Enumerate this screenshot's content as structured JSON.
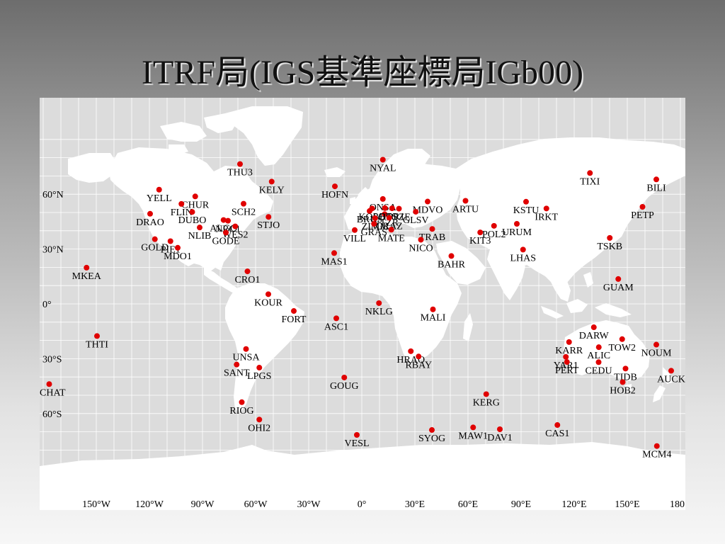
{
  "title": "ITRF局(IGS基準座標局IGb00)",
  "colors": {
    "ocean": "#dcdcdc",
    "land": "#ffffff",
    "grid": "#ffffff",
    "marker": "#e00000",
    "text": "#000000"
  },
  "lat_labels": [
    "60°N",
    "30°N",
    "0°",
    "30°S",
    "60°S"
  ],
  "lon_labels": [
    "150°W",
    "120°W",
    "90°W",
    "60°W",
    "30°W",
    "0°",
    "30°E",
    "60°E",
    "90°E",
    "120°E",
    "150°E",
    "180"
  ],
  "stations": [
    {
      "name": "NYAL",
      "lon": 11.9,
      "lat": 78.9
    },
    {
      "name": "THU3",
      "lon": -68.8,
      "lat": 76.5
    },
    {
      "name": "TIXI",
      "lon": 128.9,
      "lat": 71.6
    },
    {
      "name": "BILI",
      "lon": 166.4,
      "lat": 68.1
    },
    {
      "name": "KELY",
      "lon": -50.9,
      "lat": 66.9
    },
    {
      "name": "HOFN",
      "lon": -15.2,
      "lat": 64.3
    },
    {
      "name": "YELL",
      "lon": -114.5,
      "lat": 62.5
    },
    {
      "name": "CHUR",
      "lon": -94.1,
      "lat": 58.8
    },
    {
      "name": "ONSA",
      "lon": 11.9,
      "lat": 57.4
    },
    {
      "name": "ARTU",
      "lon": 58.6,
      "lat": 56.4
    },
    {
      "name": "KSTU",
      "lon": 92.8,
      "lat": 55.9
    },
    {
      "name": "SCH2",
      "lon": -66.8,
      "lat": 54.8
    },
    {
      "name": "FLIN",
      "lon": -101.9,
      "lat": 54.7
    },
    {
      "name": "IRKT",
      "lon": 104.3,
      "lat": 52.2
    },
    {
      "name": "PETP",
      "lon": 158.6,
      "lat": 53.1
    },
    {
      "name": "DRAO",
      "lon": -119.6,
      "lat": 49.3
    },
    {
      "name": "DUBO",
      "lon": -95.8,
      "lat": 50.3
    },
    {
      "name": "STJO",
      "lon": -52.7,
      "lat": 47.6
    },
    {
      "name": "WTZR",
      "lon": 12.9,
      "lat": 49.1
    },
    {
      "name": "POTS",
      "lon": 13.1,
      "lat": 52.4
    },
    {
      "name": "BOR1",
      "lon": 17.1,
      "lat": 52.3
    },
    {
      "name": "JOZE",
      "lon": 21.0,
      "lat": 52.1
    },
    {
      "name": "MDVO",
      "lon": 37.2,
      "lat": 56.0
    },
    {
      "name": "GLSV",
      "lon": 30.5,
      "lat": 50.4
    },
    {
      "name": "BRUS",
      "lon": 4.4,
      "lat": 50.8
    },
    {
      "name": "KOSG",
      "lon": 5.8,
      "lat": 52.2
    },
    {
      "name": "ZIMM",
      "lon": 7.5,
      "lat": 46.9
    },
    {
      "name": "GRAZ",
      "lon": 15.5,
      "lat": 47.1
    },
    {
      "name": "GRAS",
      "lon": 6.9,
      "lat": 43.8
    },
    {
      "name": "VILL",
      "lon": -4.0,
      "lat": 40.4
    },
    {
      "name": "MATE",
      "lon": 16.7,
      "lat": 40.6
    },
    {
      "name": "TRAB",
      "lon": 39.8,
      "lat": 41.0
    },
    {
      "name": "ALGO",
      "lon": -78.1,
      "lat": 45.9
    },
    {
      "name": "NRC1",
      "lon": -75.6,
      "lat": 45.5
    },
    {
      "name": "WES2",
      "lon": -71.5,
      "lat": 42.4
    },
    {
      "name": "NLIB",
      "lon": -91.6,
      "lat": 41.8
    },
    {
      "name": "GODE",
      "lon": -76.8,
      "lat": 39.0
    },
    {
      "name": "POL2",
      "lon": 74.7,
      "lat": 42.7
    },
    {
      "name": "URUM",
      "lon": 87.6,
      "lat": 43.8
    },
    {
      "name": "KIT3",
      "lon": 66.9,
      "lat": 39.1
    },
    {
      "name": "NICO",
      "lon": 33.4,
      "lat": 35.1
    },
    {
      "name": "TSKB",
      "lon": 140.1,
      "lat": 36.1
    },
    {
      "name": "GOLD",
      "lon": -116.9,
      "lat": 35.4
    },
    {
      "name": "PIE1",
      "lon": -108.1,
      "lat": 34.3
    },
    {
      "name": "MDO1",
      "lon": -104.0,
      "lat": 30.7
    },
    {
      "name": "LHAS",
      "lon": 91.1,
      "lat": 29.7
    },
    {
      "name": "MAS1",
      "lon": -15.6,
      "lat": 27.8
    },
    {
      "name": "BAHR",
      "lon": 50.6,
      "lat": 26.2
    },
    {
      "name": "MKEA",
      "lon": -155.5,
      "lat": 19.8
    },
    {
      "name": "CRO1",
      "lon": -64.6,
      "lat": 17.8
    },
    {
      "name": "GUAM",
      "lon": 144.9,
      "lat": 13.6
    },
    {
      "name": "KOUR",
      "lon": -52.8,
      "lat": 5.3
    },
    {
      "name": "NKLG",
      "lon": 9.7,
      "lat": 0.4
    },
    {
      "name": "FORT",
      "lon": -38.4,
      "lat": -3.9
    },
    {
      "name": "MALI",
      "lon": 40.2,
      "lat": -3.0
    },
    {
      "name": "ASC1",
      "lon": -14.4,
      "lat": -7.9
    },
    {
      "name": "DARW",
      "lon": 131.1,
      "lat": -12.8
    },
    {
      "name": "THTI",
      "lon": -149.6,
      "lat": -17.6
    },
    {
      "name": "KARR",
      "lon": 117.1,
      "lat": -20.9
    },
    {
      "name": "TOW2",
      "lon": 147.1,
      "lat": -19.3
    },
    {
      "name": "ALIC",
      "lon": 133.9,
      "lat": -23.7
    },
    {
      "name": "NOUM",
      "lon": 166.4,
      "lat": -22.3
    },
    {
      "name": "UNSA",
      "lon": -65.4,
      "lat": -24.7
    },
    {
      "name": "HRAO",
      "lon": 27.7,
      "lat": -25.9
    },
    {
      "name": "RBAY",
      "lon": 32.1,
      "lat": -28.8
    },
    {
      "name": "YAR1",
      "lon": 115.3,
      "lat": -29.0
    },
    {
      "name": "PERT",
      "lon": 115.9,
      "lat": -31.8
    },
    {
      "name": "CEDU",
      "lon": 133.8,
      "lat": -31.9
    },
    {
      "name": "SANT",
      "lon": -70.7,
      "lat": -33.2
    },
    {
      "name": "LPGS",
      "lon": -57.9,
      "lat": -34.9
    },
    {
      "name": "TIDB",
      "lon": 149.0,
      "lat": -35.4
    },
    {
      "name": "AUCK",
      "lon": 174.8,
      "lat": -36.6
    },
    {
      "name": "CHAT",
      "lon": -176.6,
      "lat": -43.9
    },
    {
      "name": "GOUG",
      "lon": -9.9,
      "lat": -40.3
    },
    {
      "name": "HOB2",
      "lon": 147.4,
      "lat": -42.8
    },
    {
      "name": "KERG",
      "lon": 70.3,
      "lat": -49.4
    },
    {
      "name": "RIOG",
      "lon": -67.8,
      "lat": -53.8
    },
    {
      "name": "OHI2",
      "lon": -57.9,
      "lat": -63.3
    },
    {
      "name": "CAS1",
      "lon": 110.5,
      "lat": -66.3
    },
    {
      "name": "MAW1",
      "lon": 62.9,
      "lat": -67.6
    },
    {
      "name": "DAV1",
      "lon": 78.0,
      "lat": -68.6
    },
    {
      "name": "SYOG",
      "lon": 39.6,
      "lat": -69.0
    },
    {
      "name": "VESL",
      "lon": -2.8,
      "lat": -71.7
    },
    {
      "name": "MCM4",
      "lon": 166.7,
      "lat": -77.8
    }
  ]
}
